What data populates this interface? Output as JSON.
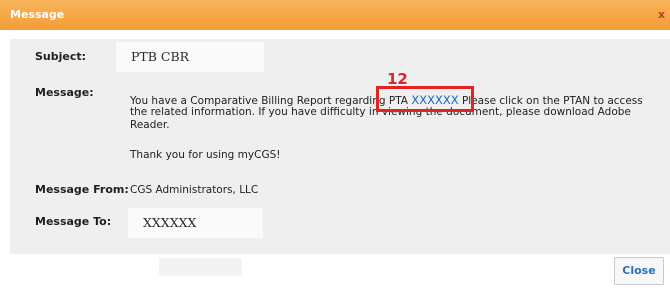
{
  "window": {
    "title": "Message",
    "close_glyph": "x"
  },
  "fields": {
    "subject_label": "Subject:",
    "subject_value": "PTB CBR",
    "message_label": "Message:",
    "message_line1_pre": "You have a Comparative Billing Report regarding PTA",
    "message_ptan": "XXXXXX",
    "message_line1_post": "Please click on the PTAN to access",
    "message_line2": "the related information. If you have difficulty in viewing the document, please download Adobe",
    "message_line3": "Reader.",
    "message_thanks": "Thank you for using myCGS!",
    "from_label": "Message From:",
    "from_value": "CGS Administrators, LLC",
    "to_label": "Message To:",
    "to_value": "XXXXXX"
  },
  "annotation": {
    "step_number": "12",
    "color": "#e02424"
  },
  "footer": {
    "close_label": "Close"
  },
  "colors": {
    "title_bar": "#f49d36",
    "link": "#1a62c4",
    "body_bg": "#efefef"
  }
}
